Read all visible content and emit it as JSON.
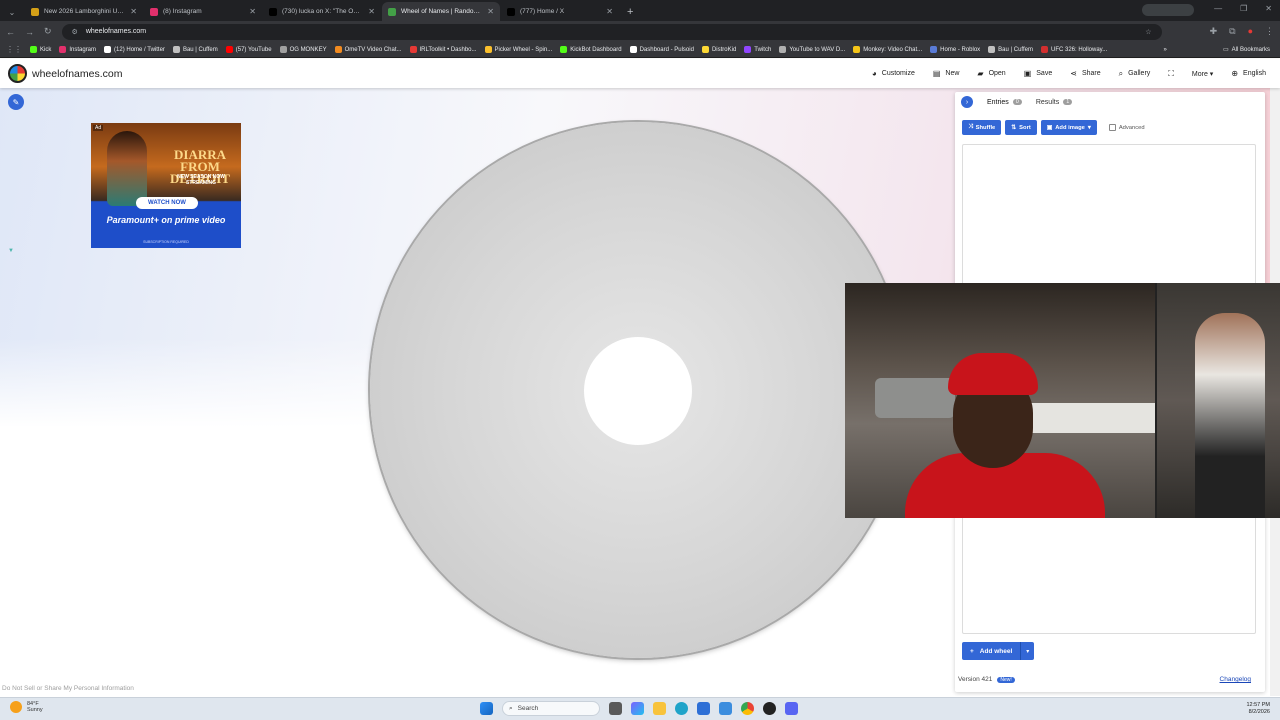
{
  "browser": {
    "tabs": [
      {
        "title": "New 2026 Lamborghini Urus S",
        "active": false,
        "color": "#d4a017"
      },
      {
        "title": "(8) Instagram",
        "active": false,
        "color": "#e1306c"
      },
      {
        "title": "(730) lucka on X: \"The ONLY th",
        "active": false,
        "color": "#000000"
      },
      {
        "title": "Wheel of Names | Random nam",
        "active": true,
        "color": "#43a047"
      },
      {
        "title": "(777) Home / X",
        "active": false,
        "color": "#000000"
      }
    ],
    "url": "wheelofnames.com",
    "bookmarks": [
      {
        "label": "Kick",
        "color": "#53fc18"
      },
      {
        "label": "Instagram",
        "color": "#e1306c"
      },
      {
        "label": "(12) Home / Twitter",
        "color": "#ffffff"
      },
      {
        "label": "Bau | Cuffem",
        "color": "#c0c0c0"
      },
      {
        "label": "(57) YouTube",
        "color": "#ff0000"
      },
      {
        "label": "OG MONKEY",
        "color": "#a0a0a0"
      },
      {
        "label": "OmeTV Video Chat...",
        "color": "#f28b20"
      },
      {
        "label": "IRLToolkit • Dashbo...",
        "color": "#e53935"
      },
      {
        "label": "Picker Wheel - Spin...",
        "color": "#fbc02d"
      },
      {
        "label": "KickBot Dashboard",
        "color": "#53fc18"
      },
      {
        "label": "Dashboard - Pulsoid",
        "color": "#ffffff"
      },
      {
        "label": "DistroKid",
        "color": "#fdd835"
      },
      {
        "label": "Twitch",
        "color": "#9146ff"
      },
      {
        "label": "YouTube to WAV D...",
        "color": "#b0b0b0"
      },
      {
        "label": "Monkey: Video Chat...",
        "color": "#f5c518"
      },
      {
        "label": "Home - Roblox",
        "color": "#5a7bd6"
      },
      {
        "label": "Bau | Cuffem",
        "color": "#c0c0c0"
      },
      {
        "label": "UFC 326: Holloway...",
        "color": "#d32f2f"
      }
    ],
    "all_bookmarks": "All Bookmarks"
  },
  "site": {
    "name": "wheelofnames.com",
    "menu": [
      {
        "icon": "palette-icon",
        "glyph": "◕",
        "label": "Customize"
      },
      {
        "icon": "new-file-icon",
        "glyph": "▤",
        "label": "New"
      },
      {
        "icon": "folder-icon",
        "glyph": "▰",
        "label": "Open"
      },
      {
        "icon": "save-icon",
        "glyph": "▣",
        "label": "Save"
      },
      {
        "icon": "share-icon",
        "glyph": "⋖",
        "label": "Share"
      },
      {
        "icon": "search-icon",
        "glyph": "⌕",
        "label": "Gallery"
      },
      {
        "icon": "fullscreen-icon",
        "glyph": "⛶",
        "label": ""
      },
      {
        "icon": "more-icon",
        "glyph": "",
        "label": "More ▾"
      },
      {
        "icon": "globe-icon",
        "glyph": "⊕",
        "label": "English"
      }
    ]
  },
  "ad": {
    "label": "Ad",
    "title": "DIARRA FROM DETROIT",
    "subtitle": "NEW SEASON NOW STREAMING",
    "cta": "WATCH NOW",
    "brands": "Paramount+ on prime video",
    "fine_print": "SUBSCRIPTION REQUIRED"
  },
  "panel": {
    "tabs": [
      {
        "label": "Entries",
        "count": "0"
      },
      {
        "label": "Results",
        "count": "1"
      }
    ],
    "buttons": {
      "shuffle": "Shuffle",
      "sort": "Sort",
      "add_image": "Add image",
      "advanced": "Advanced"
    },
    "add_wheel": "Add wheel",
    "version": "Version 421",
    "new_badge": "New!",
    "changelog": "Changelog"
  },
  "footer_link": "Do Not Sell or Share My Personal Information",
  "taskbar": {
    "temperature": "84°F",
    "condition": "Sunny",
    "search_placeholder": "Search",
    "time": "12:57 PM",
    "date": "8/2/2026"
  }
}
